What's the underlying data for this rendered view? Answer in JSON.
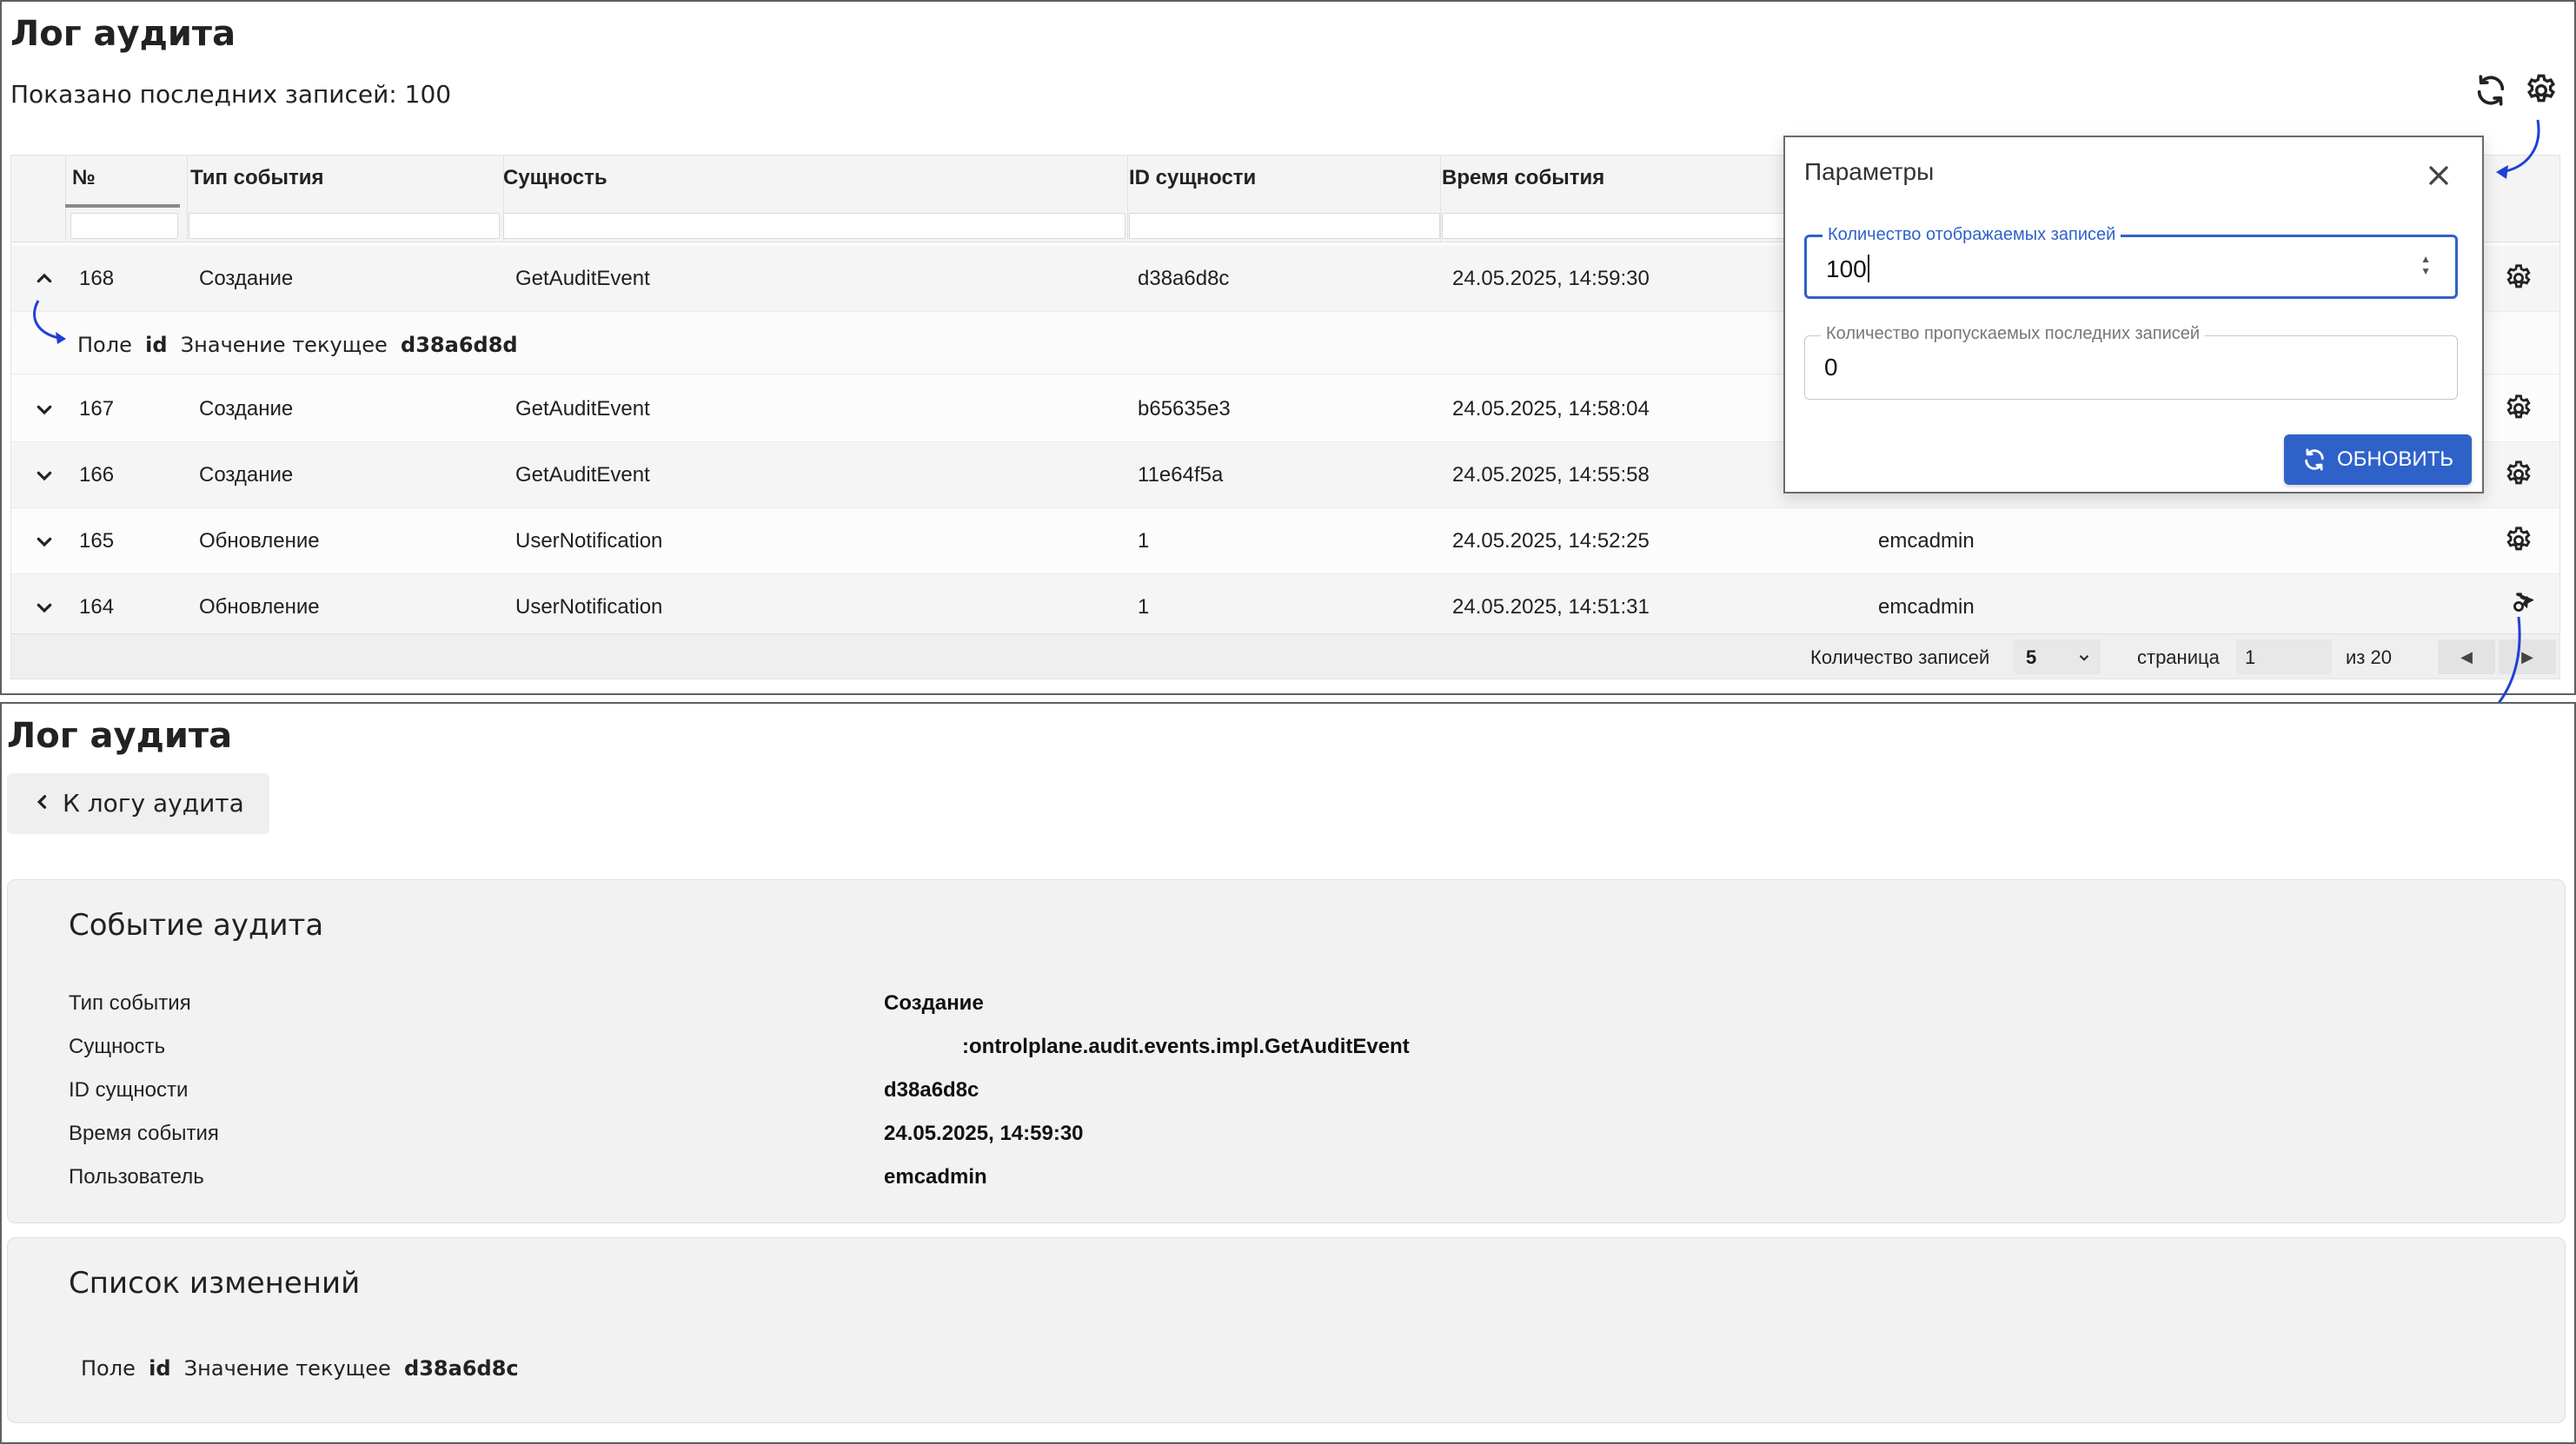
{
  "top": {
    "title": "Лог аудита",
    "shown_text": "Показано последних записей: 100",
    "columns": [
      "№",
      "Тип события",
      "Сущность",
      "ID сущности",
      "Время события"
    ],
    "expanded_row": {
      "num": "168",
      "type": "Создание",
      "entity": "GetAuditEvent",
      "entity_id": "d38a6d8c",
      "time": "24.05.2025, 14:59:30",
      "detail": {
        "field_label": "Поле",
        "field_name": "id",
        "value_label": "Значение текущее",
        "value": "d38a6d8d"
      }
    },
    "rows": [
      {
        "num": "167",
        "type": "Создание",
        "entity": "GetAuditEvent",
        "entity_id": "b65635e3",
        "time": "24.05.2025, 14:58:04",
        "user": ""
      },
      {
        "num": "166",
        "type": "Создание",
        "entity": "GetAuditEvent",
        "entity_id": "11e64f5a",
        "time": "24.05.2025, 14:55:58",
        "user": ""
      },
      {
        "num": "165",
        "type": "Обновление",
        "entity": "UserNotification",
        "entity_id": "1",
        "time": "24.05.2025, 14:52:25",
        "user": "emcadmin"
      },
      {
        "num": "164",
        "type": "Обновление",
        "entity": "UserNotification",
        "entity_id": "1",
        "time": "24.05.2025, 14:51:31",
        "user": "emcadmin"
      }
    ],
    "footer": {
      "count_label": "Количество записей",
      "count_value": "5",
      "page_label": "страница",
      "page_value": "1",
      "of_label": "из 20"
    }
  },
  "popup": {
    "title": "Параметры",
    "field1_label": "Количество отображаемых записей",
    "field1_value": "100",
    "field2_label": "Количество пропускаемых последних записей",
    "field2_value": "0",
    "refresh_label": "ОБНОВИТЬ",
    "accent": "#2f62c9"
  },
  "bottom": {
    "title": "Лог аудита",
    "back_label": "К логу аудита",
    "event_card": {
      "title": "Событие аудита",
      "labels": [
        "Тип события",
        "Сущность",
        "ID сущности",
        "Время события",
        "Пользователь"
      ],
      "values": [
        "Создание",
        ":ontrolplane.audit.events.impl.GetAuditEvent",
        "d38a6d8c",
        "24.05.2025, 14:59:30",
        "emcadmin"
      ]
    },
    "changes_card": {
      "title": "Список изменений",
      "field_label": "Поле",
      "field_name": "id",
      "value_label": "Значение текущее",
      "value": "d38a6d8c"
    }
  },
  "arrow_color": "#1f3fd6"
}
